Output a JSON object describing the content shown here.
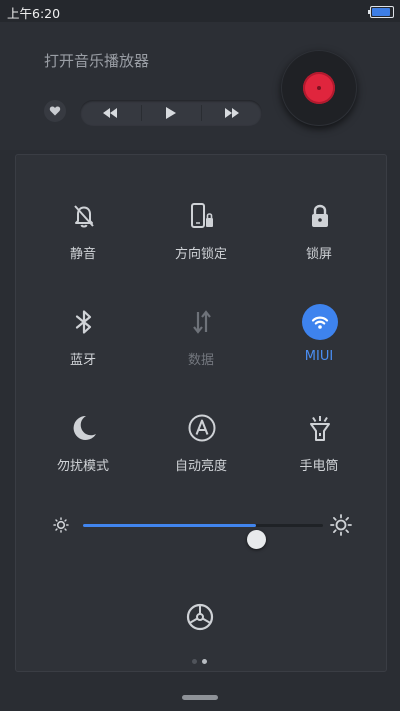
{
  "status_bar": {
    "time": "上午6:20",
    "battery_level": 0.9,
    "battery_color": "#3d7ee6"
  },
  "music_player": {
    "title": "打开音乐播放器",
    "icons": [
      "heart-icon",
      "previous-icon",
      "play-icon",
      "next-icon"
    ],
    "disc_color": "#e0253d"
  },
  "toggles": [
    {
      "id": "silent",
      "label": "静音",
      "icon": "bell-off-icon",
      "state": "off"
    },
    {
      "id": "rotation-lock",
      "label": "方向锁定",
      "icon": "rotation-lock-icon",
      "state": "off"
    },
    {
      "id": "lock-screen",
      "label": "锁屏",
      "icon": "lock-icon",
      "state": "off"
    },
    {
      "id": "bluetooth",
      "label": "蓝牙",
      "icon": "bluetooth-icon",
      "state": "off"
    },
    {
      "id": "data",
      "label": "数据",
      "icon": "data-arrows-icon",
      "state": "disabled"
    },
    {
      "id": "wifi",
      "label": "MIUI",
      "icon": "wifi-icon",
      "state": "on"
    },
    {
      "id": "do-not-disturb",
      "label": "勿扰模式",
      "icon": "moon-icon",
      "state": "off"
    },
    {
      "id": "auto-brightness",
      "label": "自动亮度",
      "icon": "auto-brightness-icon",
      "state": "off"
    },
    {
      "id": "flashlight",
      "label": "手电筒",
      "icon": "flashlight-icon",
      "state": "off"
    }
  ],
  "brightness": {
    "level": 0.72,
    "accent": "#4185ee"
  },
  "pager": {
    "pages": 2,
    "current": 2
  },
  "accent_color": "#3e83ee"
}
